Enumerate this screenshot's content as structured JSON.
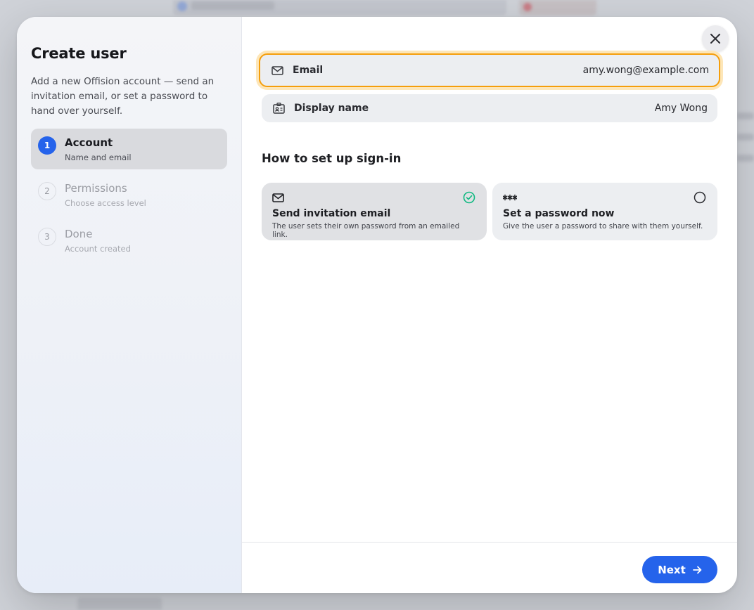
{
  "sidebar": {
    "title": "Create user",
    "description": "Add a new Offision account — send an invitation email, or set a password to hand over yourself.",
    "steps": [
      {
        "number": "1",
        "title": "Account",
        "subtitle": "Name and email",
        "active": true
      },
      {
        "number": "2",
        "title": "Permissions",
        "subtitle": "Choose access level",
        "active": false
      },
      {
        "number": "3",
        "title": "Done",
        "subtitle": "Account created",
        "active": false
      }
    ]
  },
  "form": {
    "email": {
      "label": "Email",
      "value": "amy.wong@example.com",
      "icon": "mail-icon"
    },
    "display_name": {
      "label": "Display name",
      "value": "Amy Wong",
      "icon": "id-card-icon"
    }
  },
  "signin": {
    "title": "How to set up sign-in",
    "options": [
      {
        "icon": "mail-icon",
        "title": "Send invitation email",
        "description": "The user sets their own password from an emailed link.",
        "selected": true
      },
      {
        "icon": "password-icon",
        "title": "Set a password now",
        "description": "Give the user a password to share with them yourself.",
        "selected": false
      }
    ]
  },
  "footer": {
    "next_label": "Next"
  },
  "colors": {
    "accent": "#2563eb",
    "focus": "#f59e0b",
    "check": "#10b981"
  }
}
